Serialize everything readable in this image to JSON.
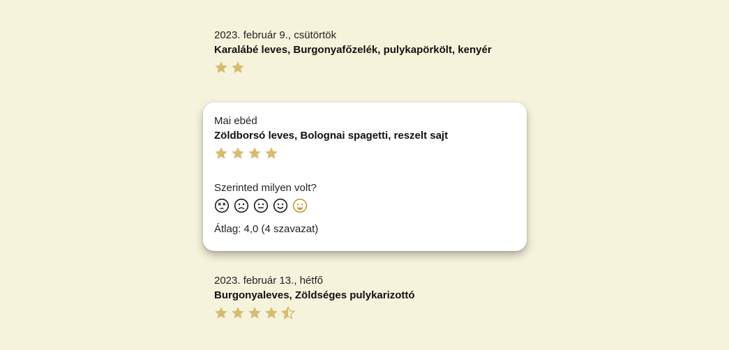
{
  "colors": {
    "background": "#f5f3dc",
    "star": "#d8bb6e",
    "card": "#ffffff",
    "face_active": "#c79a3a"
  },
  "entries": [
    {
      "date": "2023. február 9., csütörtök",
      "menu": "Karalábé leves, Burgonyafőzelék, pulykapörkölt, kenyér",
      "rating": 2
    },
    {
      "date": "2023. február 13., hétfő",
      "menu": "Burgonyaleves, Zöldséges pulykarizottó",
      "rating": 4.5
    }
  ],
  "today": {
    "label": "Mai ebéd",
    "menu": "Zöldborsó leves, Bolognai spagetti, reszelt sajt",
    "rating": 4,
    "question": "Szerinted milyen volt?",
    "faces": [
      "very-sad-face-icon",
      "sad-face-icon",
      "neutral-face-icon",
      "smile-face-icon",
      "grin-face-icon"
    ],
    "selected_face_index": 4,
    "average_text": "Átlag: 4,0 (4 szavazat)"
  }
}
